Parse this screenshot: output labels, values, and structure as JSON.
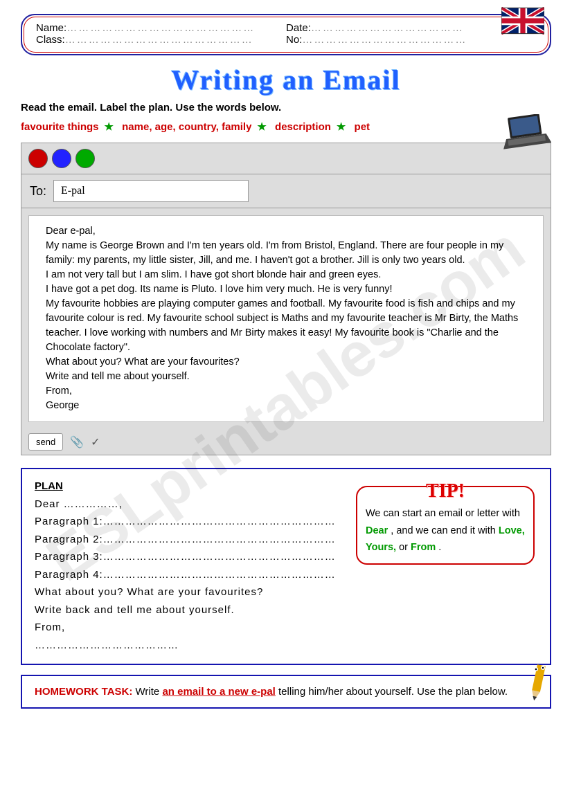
{
  "header": {
    "name_label": "Name:",
    "date_label": "Date:",
    "class_label": "Class:",
    "no_label": "No:"
  },
  "title": "Writing an Email",
  "instruction": "Read the email. Label the plan. Use the words below.",
  "word_bank": [
    "favourite things",
    "name, age, country, family",
    "description",
    "pet"
  ],
  "email": {
    "to_label": "To:",
    "to_value": "E-pal",
    "body": [
      "Dear e-pal,",
      "My name is George Brown and I'm ten years old. I'm from Bristol, England. There are four people in my family: my parents, my little sister, Jill, and me. I haven't got a brother. Jill is only two years old.",
      "I am not very tall but I am slim. I have got short blonde hair and green eyes.",
      "I have got a pet dog. Its name is Pluto. I love him very much. He is very funny!",
      "My favourite hobbies are playing computer games and football. My favourite food is fish and chips and my favourite colour is red. My favourite school subject is Maths and my favourite teacher is Mr Birty, the Maths teacher. I love working with numbers and Mr Birty makes it easy! My favourite book is \"Charlie and the Chocolate factory\".",
      "What about you? What are your favourites?",
      "Write and tell me about yourself.",
      "From,",
      "George"
    ],
    "send_label": "send"
  },
  "plan": {
    "title": "PLAN",
    "lines": [
      "Dear ……………,",
      "Paragraph 1:………………………………………………………",
      "Paragraph 2:………………………………………………………",
      "Paragraph 3:………………………………………………………",
      "Paragraph 4:………………………………………………………",
      "What about you? What are your favourites?",
      "Write back and tell me about yourself.",
      "From,",
      "…………………………………"
    ]
  },
  "tip": {
    "badge": "TIP!",
    "text_parts": [
      "We can start an email or letter with ",
      "Dear",
      ", and we can end it with ",
      "Love, Yours,",
      " or ",
      "From",
      "."
    ]
  },
  "homework": {
    "label": "HOMEWORK TASK:",
    "task_underlined": "an email to a new e-pal",
    "text_before": " Write ",
    "text_after": " telling him/her about yourself. Use the plan below."
  },
  "watermark": "ESLprintables.com"
}
